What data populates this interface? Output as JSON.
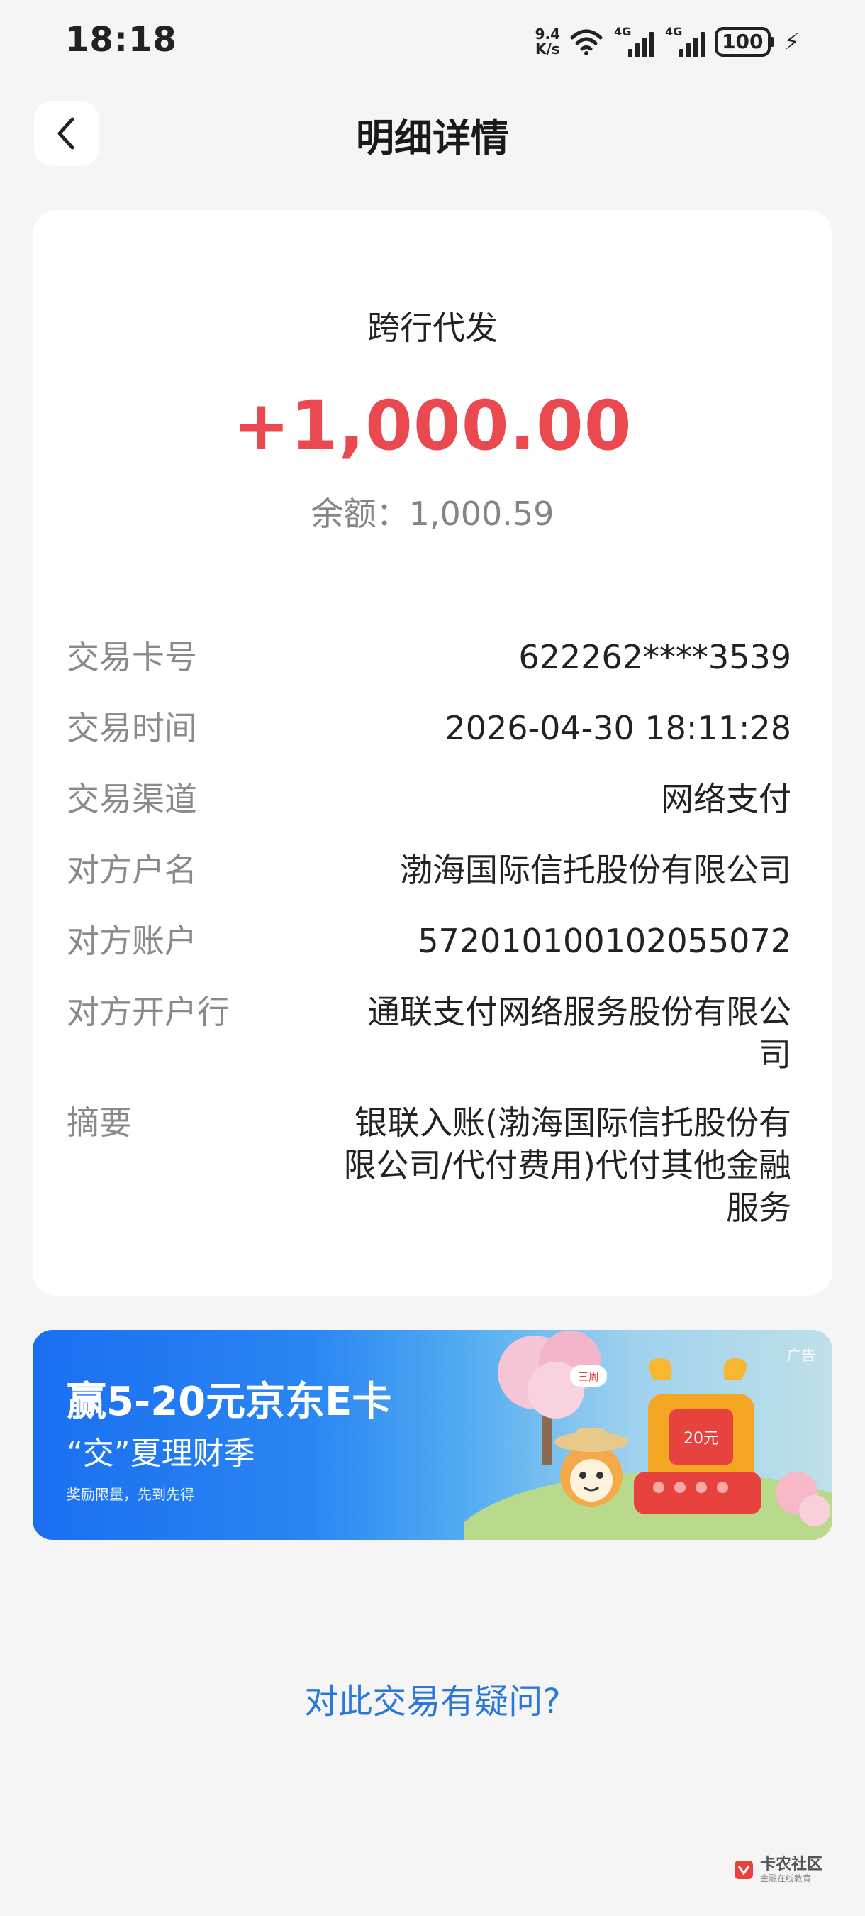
{
  "status_bar": {
    "time": "18:18",
    "net_speed_value": "9.4",
    "net_speed_unit": "K/s",
    "sim1": "4G",
    "sim2": "4G",
    "battery": "100"
  },
  "header": {
    "title": "明细详情"
  },
  "transaction": {
    "type": "跨行代发",
    "amount": "+1,000.00",
    "balance": "余额：1,000.59"
  },
  "details": [
    {
      "label": "交易卡号",
      "value": "622262****3539"
    },
    {
      "label": "交易时间",
      "value": "2026-04-30 18:11:28"
    },
    {
      "label": "交易渠道",
      "value": "网络支付"
    },
    {
      "label": "对方户名",
      "value": "渤海国际信托股份有限公司"
    },
    {
      "label": "对方账户",
      "value": "572010100102055072"
    },
    {
      "label": "对方开户行",
      "value": "通联支付网络服务股份有限公司"
    },
    {
      "label": "摘要",
      "value": "银联入账(渤海国际信托股份有限公司/代付费用)代付其他金融服务"
    }
  ],
  "banner": {
    "title": "赢5-20元京东E卡",
    "subtitle": "“交”夏理财季",
    "note": "奖励限量，先到先得",
    "ad_label": "广告",
    "art_badge": "三周",
    "art_voucher": "20元"
  },
  "question_link": "对此交易有疑问?",
  "watermark": {
    "title": "卡农社区",
    "subtitle": "金融在线教育"
  },
  "colors": {
    "amount": "#ea4a4f",
    "link": "#2b78d8",
    "banner_start": "#1a6ff0"
  }
}
